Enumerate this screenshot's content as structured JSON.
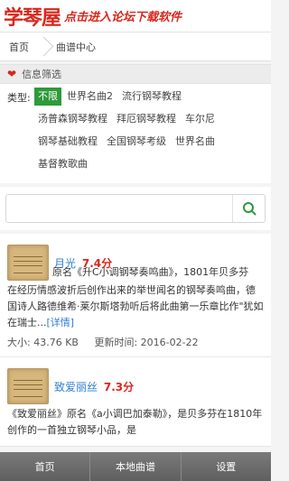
{
  "header": {
    "logo": "学琴屋",
    "slogan": "点击进入论坛下载软件"
  },
  "breadcrumb": {
    "home": "首页",
    "current": "曲谱中心"
  },
  "filter": {
    "heading": "信息筛选",
    "type_label": "类型:",
    "tags": [
      "不限",
      "世界名曲2",
      "流行钢琴教程",
      "汤普森钢琴教程",
      "拜厄钢琴教程",
      "车尔尼",
      "钢琴基础教程",
      "全国钢琴考级",
      "世界名曲",
      "基督教歌曲"
    ],
    "active_tag": "不限"
  },
  "search": {
    "placeholder": "",
    "button_icon": "search-icon"
  },
  "songs": [
    {
      "title": "月光",
      "score": "7.4分",
      "description_lead": "原名《升C小调钢琴奏鸣曲》，1801年贝多芬",
      "description_rest": "在经历情感波折后创作出来的举世闻名的钢琴奏鸣曲，德国诗人路德维希·莱尔斯塔勃听后将此曲第一乐章比作\"犹如在瑞士...",
      "detail_link": "[详情]",
      "size": "大小: 43.76 KB",
      "updated": "更新时间: 2016-02-22"
    },
    {
      "title": "致爱丽丝",
      "score": "7.3分",
      "description_full": "《致爱丽丝》原名《a小调巴加泰勒》，是贝多芬在1810年创作的一首独立钢琴小品，是"
    }
  ],
  "bottom_nav": {
    "home": "首页",
    "local": "本地曲谱",
    "settings": "设置"
  },
  "colors": {
    "brand_red": "#d9261c",
    "active_green": "#2e9a3a",
    "link_blue": "#2e7dd1"
  }
}
